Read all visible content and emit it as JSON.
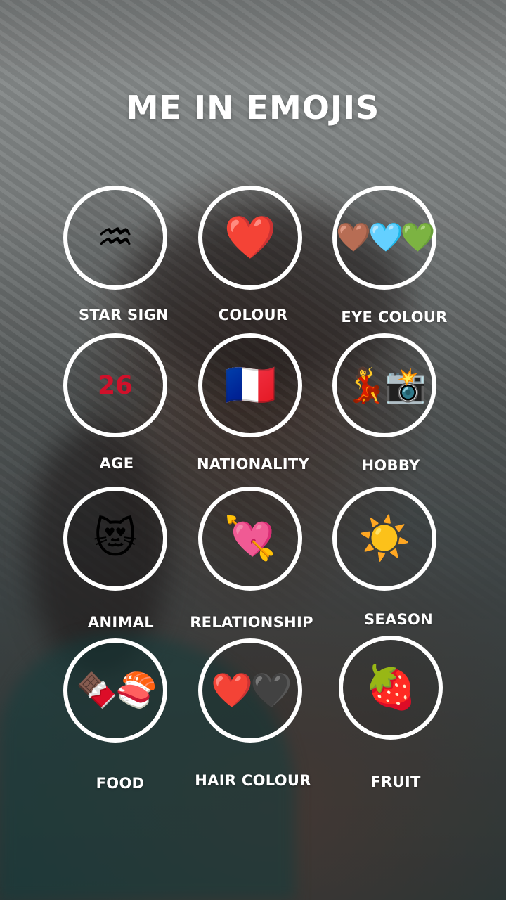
{
  "title": "ME IN EMOJIS",
  "items": [
    {
      "label": "STAR SIGN",
      "emoji": "♒",
      "icon": "aquarius-icon"
    },
    {
      "label": "COLOUR",
      "emoji": "❤️",
      "icon": "red-heart-icon"
    },
    {
      "label": "EYE COLOUR",
      "emoji": "🤎🩵💚",
      "icon": "brown-blue-green-hearts-icon"
    },
    {
      "label": "AGE",
      "value": "26"
    },
    {
      "label": "NATIONALITY",
      "emoji": "🇫🇷",
      "icon": "france-flag-icon"
    },
    {
      "label": "HOBBY",
      "emoji": "💃📸",
      "icon": "dancer-camera-icon"
    },
    {
      "label": "ANIMAL",
      "emoji": "😻",
      "icon": "heart-eyes-cat-icon"
    },
    {
      "label": "RELATIONSHIP",
      "emoji": "💘",
      "icon": "heart-with-arrow-icon"
    },
    {
      "label": "SEASON",
      "emoji": "☀️",
      "icon": "sun-icon"
    },
    {
      "label": "FOOD",
      "emoji": "🍫🍣",
      "icon": "chocolate-sushi-icon"
    },
    {
      "label": "HAIR COLOUR",
      "emoji": "❤️🖤",
      "icon": "red-black-hearts-icon"
    },
    {
      "label": "FRUIT",
      "emoji": "🍓",
      "icon": "strawberry-icon"
    }
  ]
}
